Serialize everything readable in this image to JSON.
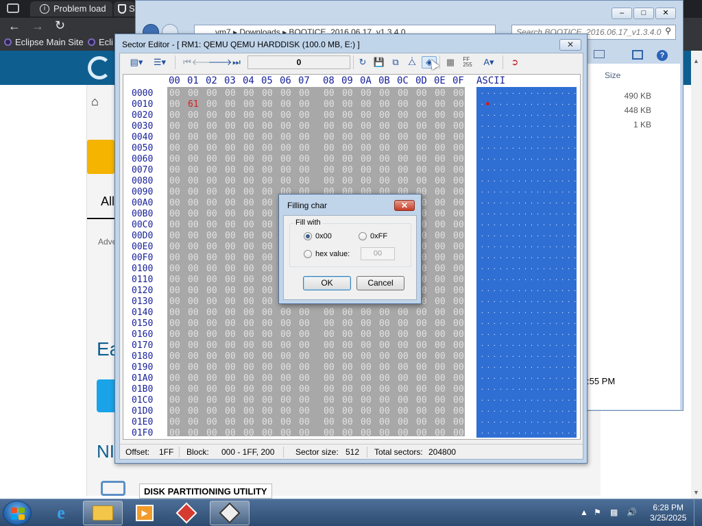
{
  "browser": {
    "tabs": [
      "Problem load",
      "S"
    ],
    "bookmarks": [
      "Eclipse Main Site",
      "Ecli"
    ],
    "page_text": {
      "all": "All",
      "adv": "Adve",
      "ea": "Ea",
      "ni": "NI",
      "disk_partitioning": "DISK PARTITIONING UTILITY"
    }
  },
  "explorer": {
    "address": "vm7 ▸ Downloads ▸ BOOTICE_2016.06.17_v1.3.4.0",
    "search_placeholder": "Search BOOTICE_2016.06.17_v1.3.4.0",
    "size_header": "Size",
    "sizes": [
      "490 KB",
      "448 KB",
      "1 KB"
    ],
    "time_fragment": ":55 PM"
  },
  "editor": {
    "title": "Sector Editor - [ RM1: QEMU QEMU HARDDISK (100.0 MB, E:) ]",
    "close_symbol": "✕",
    "sector_number": "0",
    "columns": [
      "00",
      "01",
      "02",
      "03",
      "04",
      "05",
      "06",
      "07",
      "08",
      "09",
      "0A",
      "0B",
      "0C",
      "0D",
      "0E",
      "0F"
    ],
    "ascii_header": "ASCII",
    "offsets": [
      "0000",
      "0010",
      "0020",
      "0030",
      "0040",
      "0050",
      "0060",
      "0070",
      "0080",
      "0090",
      "00A0",
      "00B0",
      "00C0",
      "00D0",
      "00E0",
      "00F0",
      "0100",
      "0110",
      "0120",
      "0130",
      "0140",
      "0150",
      "0160",
      "0170",
      "0180",
      "0190",
      "01A0",
      "01B0",
      "01C0",
      "01D0",
      "01E0",
      "01F0"
    ],
    "fill_byte": "00",
    "changed_byte": {
      "row": 1,
      "col": 1,
      "value": "61"
    },
    "colors": {
      "hex_bg": "#a8a8a8",
      "ascii_bg": "#2f6fd4",
      "changed": "#d81d1d",
      "offset_text": "#16209a"
    },
    "status": {
      "offset_label": "Offset:",
      "offset_value": "1FF",
      "block_label": "Block:",
      "block_value": "000 - 1FF, 200",
      "sector_size_label": "Sector size:",
      "sector_size_value": "512",
      "total_label": "Total sectors:",
      "total_value": "204800"
    }
  },
  "dialog": {
    "title": "Filling char",
    "close_symbol": "✕",
    "group_label": "Fill with",
    "opt_00": "0x00",
    "opt_ff": "0xFF",
    "opt_hex": "hex value:",
    "hex_value": "00",
    "selected": "0x00",
    "ok_label": "OK",
    "cancel_label": "Cancel"
  },
  "taskbar": {
    "time": "6:28 PM",
    "date": "3/25/2025"
  }
}
